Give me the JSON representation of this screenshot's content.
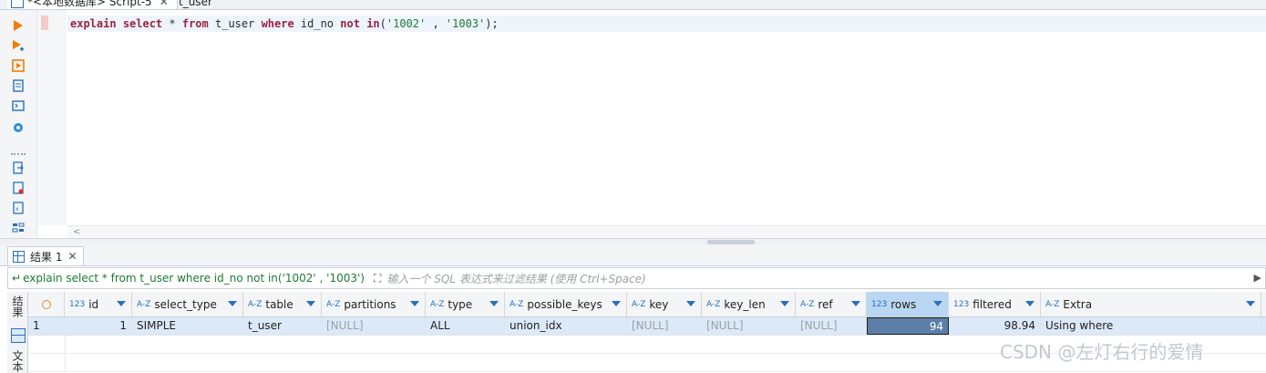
{
  "tabs": [
    {
      "label": "*<本地数据库> Script-5",
      "close": "✕"
    },
    {
      "label": "t_user"
    }
  ],
  "toolbar": {
    "icons": [
      "execute-icon",
      "execute-script-icon",
      "explain-plan-icon",
      "script-icon",
      "terminal-icon",
      "settings-icon",
      "export-icon",
      "file-icon",
      "format-icon",
      "outline-icon"
    ]
  },
  "editor": {
    "tokens": [
      {
        "t": "explain",
        "c": "kw"
      },
      {
        "t": " ",
        "c": "pl"
      },
      {
        "t": "select",
        "c": "kw"
      },
      {
        "t": " * ",
        "c": "pl"
      },
      {
        "t": "from",
        "c": "kw"
      },
      {
        "t": " t_user ",
        "c": "pl"
      },
      {
        "t": "where",
        "c": "kw"
      },
      {
        "t": " id_no ",
        "c": "pl"
      },
      {
        "t": "not",
        "c": "kw"
      },
      {
        "t": " ",
        "c": "pl"
      },
      {
        "t": "in",
        "c": "kw"
      },
      {
        "t": "(",
        "c": "pl"
      },
      {
        "t": "'1002'",
        "c": "st"
      },
      {
        "t": " , ",
        "c": "pl"
      },
      {
        "t": "'1003'",
        "c": "st"
      },
      {
        "t": ");",
        "c": "pl"
      }
    ],
    "scroll_left": "<"
  },
  "results": {
    "tab_label": "结果 1",
    "tab_close": "✕",
    "filter_query": "explain select * from t_user where id_no not in('1002' , '1003')",
    "filter_placeholder": "输入一个 SQL 表达式来过滤结果 (使用 Ctrl+Space)",
    "side_label_top": "结果",
    "side_label_bottom": "文本",
    "columns": [
      {
        "type": "123",
        "name": "id"
      },
      {
        "type": "A-Z",
        "name": "select_type"
      },
      {
        "type": "A-Z",
        "name": "table"
      },
      {
        "type": "A-Z",
        "name": "partitions"
      },
      {
        "type": "A-Z",
        "name": "type"
      },
      {
        "type": "A-Z",
        "name": "possible_keys"
      },
      {
        "type": "A-Z",
        "name": "key"
      },
      {
        "type": "A-Z",
        "name": "key_len"
      },
      {
        "type": "A-Z",
        "name": "ref"
      },
      {
        "type": "123",
        "name": "rows"
      },
      {
        "type": "123",
        "name": "filtered"
      },
      {
        "type": "A-Z",
        "name": "Extra"
      }
    ],
    "rows": [
      {
        "num": "1",
        "cells": [
          "1",
          "SIMPLE",
          "t_user",
          "[NULL]",
          "ALL",
          "union_idx",
          "[NULL]",
          "[NULL]",
          "[NULL]",
          "94",
          "98.94",
          "Using where"
        ]
      }
    ]
  },
  "watermark": "CSDN @左灯右行的爱情"
}
